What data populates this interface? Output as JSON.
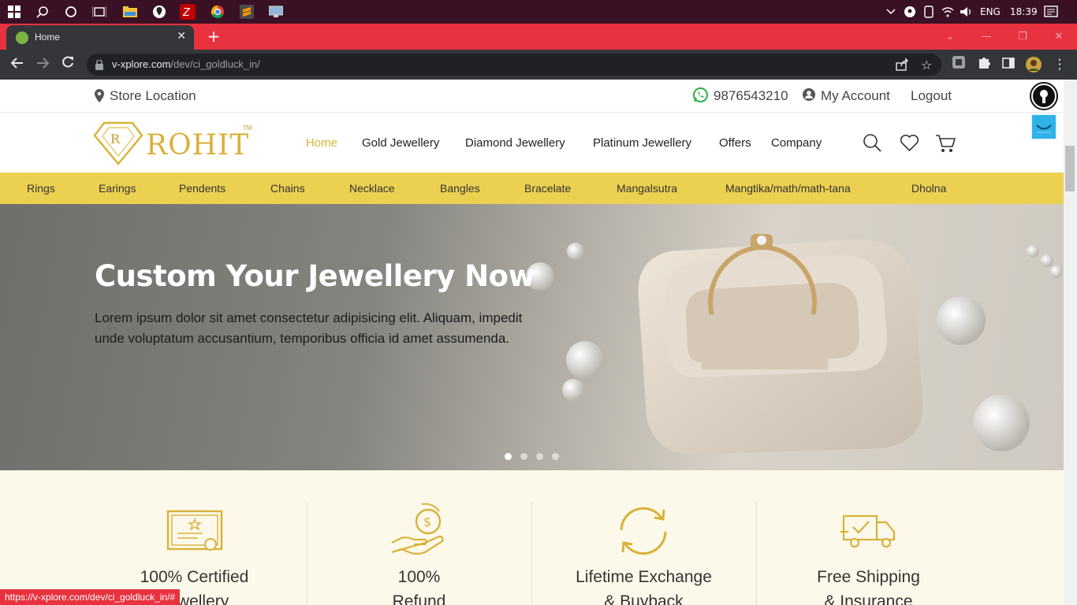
{
  "taskbar": {
    "lang": "ENG",
    "time": "18:39",
    "icons": [
      "windows-icon",
      "search-icon",
      "cortana-icon",
      "task-view-icon",
      "file-explorer-icon",
      "maps-icon",
      "filezilla-icon",
      "chrome-icon",
      "sublime-icon",
      "remote-desktop-icon"
    ]
  },
  "browser": {
    "tab_title": "Home",
    "url_host": "v-xplore.com",
    "url_path": "/dev/ci_goldluck_in/",
    "status_url": "https://v-xplore.com/dev/ci_goldluck_in/#"
  },
  "site": {
    "top": {
      "store_location": "Store Location",
      "phone": "9876543210",
      "account": "My Account",
      "logout": "Logout"
    },
    "logo_text": "ROHIT",
    "logo_tm": "TM",
    "nav": [
      "Home",
      "Gold Jewellery",
      "Diamond Jewellery",
      "Platinum Jewellery",
      "Offers",
      "Company"
    ],
    "categories": [
      "Rings",
      "Earings",
      "Pendents",
      "Chains",
      "Necklace",
      "Bangles",
      "Bracelate",
      "Mangalsutra",
      "Mangtika/math/math-tana",
      "Dholna"
    ],
    "hero": {
      "title": "Custom Your Jewellery Now",
      "text": "Lorem ipsum dolor sit amet consectetur adipisicing elit. Aliquam, impedit unde voluptatum accusantium, temporibus officia id amet assumenda.",
      "slide_count": 4,
      "active_slide": 1
    },
    "features": [
      {
        "line1": "100% Certified",
        "line2": "Jewellery"
      },
      {
        "line1": "100%",
        "line2": "Refund"
      },
      {
        "line1": "Lifetime Exchange",
        "line2": "& Buyback"
      },
      {
        "line1": "Free Shipping",
        "line2": "& Insurance"
      }
    ]
  },
  "colors": {
    "gold": "#d9b13a",
    "category_bar": "#ecd050",
    "tab_strip": "#e8323f",
    "feature_bg": "#fdf9ea"
  }
}
